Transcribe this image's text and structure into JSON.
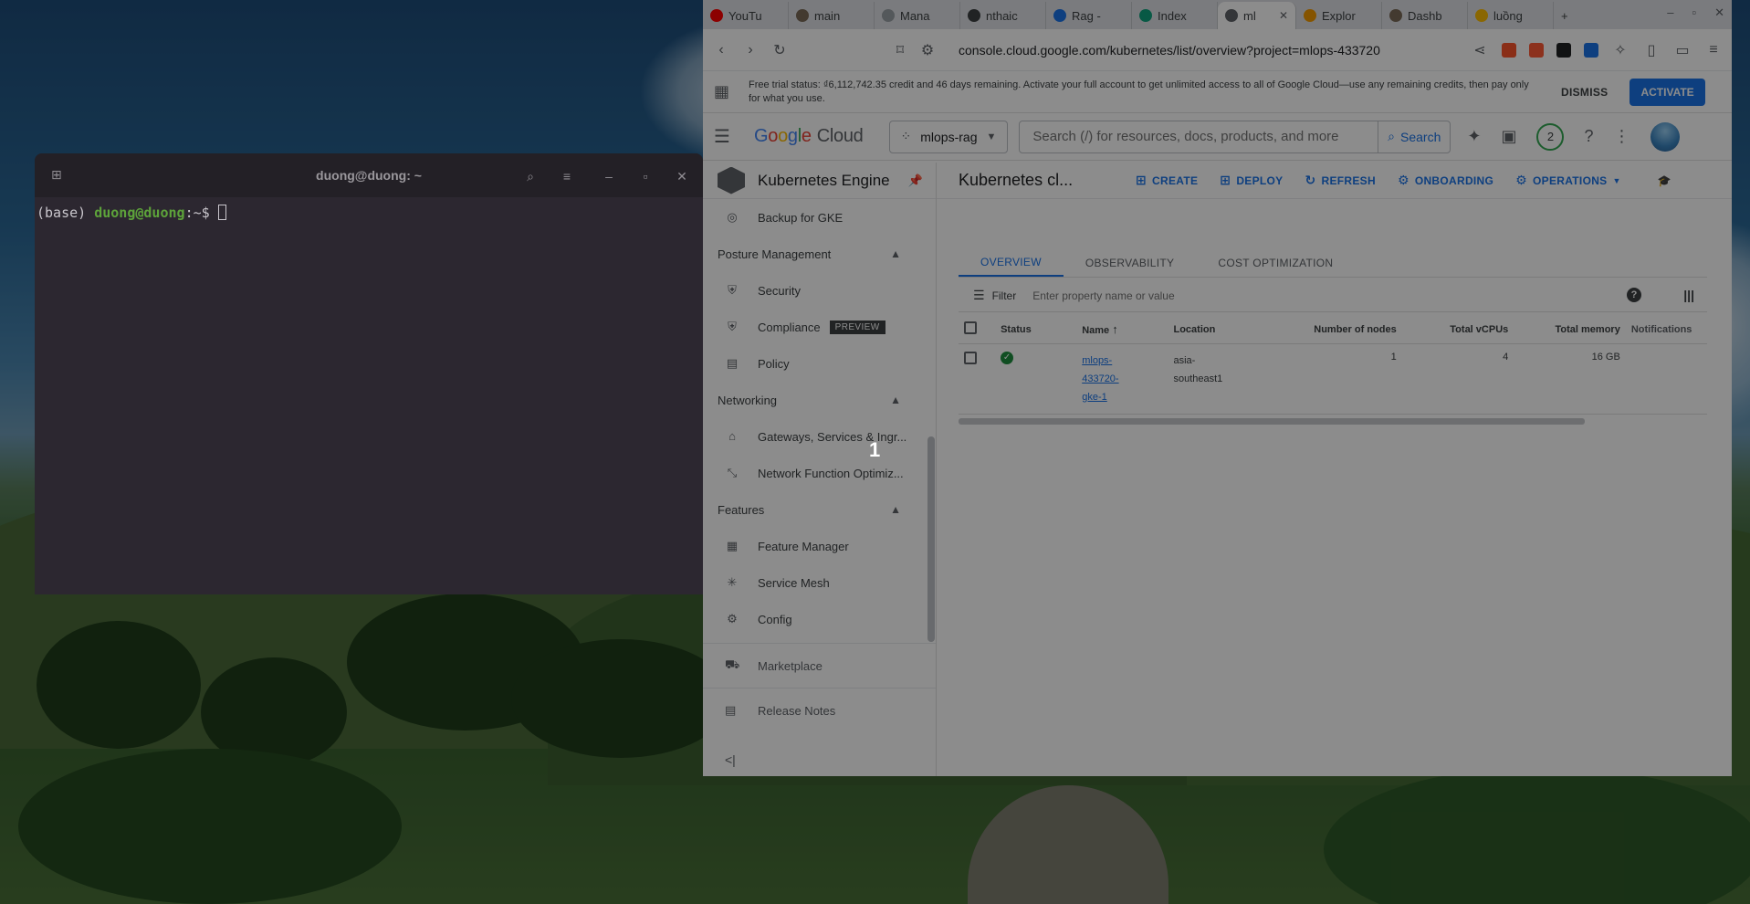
{
  "terminal": {
    "title": "duong@duong: ~",
    "prompt_env": "(base) ",
    "prompt_user": "duong@duong",
    "prompt_suffix": ":~$ "
  },
  "browser": {
    "tabs": [
      {
        "label": "YouTu",
        "color": "#ff0000"
      },
      {
        "label": "main",
        "color": "#7a6a58"
      },
      {
        "label": "Mana",
        "color": "#9aa0a6"
      },
      {
        "label": "nthaic",
        "color": "#3c4043"
      },
      {
        "label": "Rag -",
        "color": "#1a73e8"
      },
      {
        "label": "Index",
        "color": "#10a37f"
      },
      {
        "label": "ml",
        "color": "#5f6368",
        "active": true
      },
      {
        "label": "Explor",
        "color": "#f29900"
      },
      {
        "label": "Dashb",
        "color": "#7a6a58"
      },
      {
        "label": "luồng",
        "color": "#fbbc04"
      }
    ],
    "url": "console.cloud.google.com/kubernetes/list/overview?project=mlops-433720"
  },
  "trial_banner": {
    "text": "Free trial status: ₫6,112,742.35 credit and 46 days remaining. Activate your full account to get unlimited access to all of Google Cloud—use any remaining credits, then pay only for what you use.",
    "dismiss": "DISMISS",
    "activate": "ACTIVATE"
  },
  "header": {
    "logo_google": [
      "G",
      "o",
      "o",
      "g",
      "l",
      "e"
    ],
    "logo_cloud": "Cloud",
    "project": "mlops-rag",
    "search_placeholder": "Search (/) for resources, docs, products, and more",
    "search_button": "Search",
    "notifications_count": "2"
  },
  "sidebar": {
    "product": "Kubernetes Engine",
    "items": [
      {
        "type": "item",
        "label": "Backup for GKE",
        "icon": "backup-icon"
      },
      {
        "type": "section",
        "label": "Posture Management"
      },
      {
        "type": "item",
        "label": "Security",
        "icon": "security-icon"
      },
      {
        "type": "item",
        "label": "Compliance",
        "icon": "compliance-icon",
        "badge": "PREVIEW"
      },
      {
        "type": "item",
        "label": "Policy",
        "icon": "policy-icon"
      },
      {
        "type": "section",
        "label": "Networking"
      },
      {
        "type": "item",
        "label": "Gateways, Services & Ingr...",
        "icon": "gateways-icon"
      },
      {
        "type": "item",
        "label": "Network Function Optimiz...",
        "icon": "network-function-icon"
      },
      {
        "type": "section",
        "label": "Features"
      },
      {
        "type": "item",
        "label": "Feature Manager",
        "icon": "feature-manager-icon"
      },
      {
        "type": "item",
        "label": "Service Mesh",
        "icon": "service-mesh-icon"
      },
      {
        "type": "item",
        "label": "Config",
        "icon": "config-icon"
      }
    ],
    "footer": [
      "Marketplace",
      "Release Notes"
    ]
  },
  "main": {
    "title": "Kubernetes cl...",
    "actions": [
      {
        "label": "CREATE",
        "icon": "plus-box-icon"
      },
      {
        "label": "DEPLOY",
        "icon": "plus-box-icon"
      },
      {
        "label": "REFRESH",
        "icon": "refresh-icon"
      },
      {
        "label": "ONBOARDING",
        "icon": "onboarding-icon"
      },
      {
        "label": "OPERATIONS",
        "icon": "operations-icon"
      }
    ],
    "tabs": [
      "OVERVIEW",
      "OBSERVABILITY",
      "COST OPTIMIZATION"
    ],
    "filter_label": "Filter",
    "filter_placeholder": "Enter property name or value",
    "columns": [
      "Status",
      "Name",
      "Location",
      "Number of nodes",
      "Total vCPUs",
      "Total memory",
      "Notifications"
    ],
    "rows": [
      {
        "name_lines": [
          "mlops-",
          "433720-",
          "gke-1"
        ],
        "location_lines": [
          "asia-",
          "southeast1"
        ],
        "nodes": "1",
        "vcpus": "4",
        "memory": "16 GB",
        "notifications": ""
      }
    ]
  },
  "overlay_marker": "1",
  "colors": {
    "accent": "#1a73e8",
    "ok": "#1e8e3e"
  }
}
